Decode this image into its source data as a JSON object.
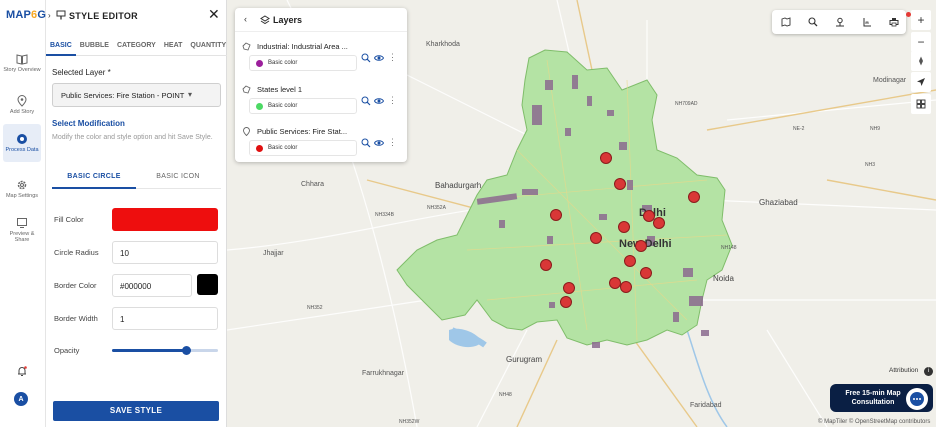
{
  "rail": {
    "logo_main": "MAP",
    "logo_accent": "6",
    "logo_tail": "G",
    "items": [
      {
        "label": "Story Overview",
        "icon": "book-icon"
      },
      {
        "label": "Add Story",
        "icon": "map-pin-icon"
      },
      {
        "label": "Process Data",
        "icon": "process-data-icon"
      },
      {
        "label": "Map Settings",
        "icon": "gear-icon"
      },
      {
        "label": "Preview & Share",
        "icon": "preview-icon"
      }
    ],
    "avatar_letter": "A"
  },
  "editor": {
    "title": "STYLE EDITOR",
    "close": "✕",
    "tabs": [
      "BASIC",
      "BUBBLE",
      "CATEGORY",
      "HEAT",
      "QUANTITY"
    ],
    "selected_layer_label": "Selected Layer *",
    "selected_layer_value": "Public Services: Fire Station - POINT",
    "select_modification": "Select Modification",
    "hint": "Modify the color and style option and hit Save Style.",
    "subtabs": [
      "BASIC CIRCLE",
      "BASIC ICON"
    ],
    "fill_color_label": "Fill Color",
    "fill_color": "#ee0e0e",
    "circle_radius_label": "Circle Radius",
    "circle_radius": "10",
    "border_color_label": "Border Color",
    "border_color": "#000000",
    "border_width_label": "Border Width",
    "border_width": "1",
    "opacity_label": "Opacity",
    "opacity": 0.7,
    "save_label": "SAVE STYLE"
  },
  "layers": {
    "title": "Layers",
    "items": [
      {
        "name": "Industrial: Industrial Area ...",
        "chip": "Basic color",
        "color": "#9c1f9c"
      },
      {
        "name": "States level 1",
        "chip": "Basic color",
        "color": "#4cd964"
      },
      {
        "name": "Public Services: Fire Stat...",
        "chip": "Basic color",
        "color": "#e01010"
      }
    ]
  },
  "map": {
    "labels": {
      "kharkhoda": "Kharkhoda",
      "modinagar": "Modinagar",
      "bahadurgarh": "Bahadurgarh",
      "chhara": "Chhara",
      "jhajjar": "Jhajjar",
      "ghaziabad": "Ghaziabad",
      "delhi": "Delhi",
      "new_delhi": "New Delhi",
      "noida": "Noida",
      "gurugram": "Gurugram",
      "farrukhnagar": "Farrukhnagar",
      "faridabad": "Faridabad",
      "nh334b": "NH334B",
      "nh709ad": "NH709AD",
      "ne2": "NE-2",
      "nh9": "NH9",
      "nh3": "NH3",
      "nh352a": "NH352A",
      "nh352": "NH352",
      "nh48": "NH48",
      "nh148": "NH148",
      "nh352w": "NH352W"
    },
    "attribution": "Attribution",
    "copyright": "© MapTiler © OpenStreetMap contributors",
    "cta": "Free 15-min Map Consultation",
    "zoom_in": "+",
    "zoom_out": "−"
  },
  "colors": {
    "brand": "#1a4fa3",
    "region_fill": "#b4e3a4",
    "marker": "#d93737",
    "industrial": "#8b6b8f"
  }
}
